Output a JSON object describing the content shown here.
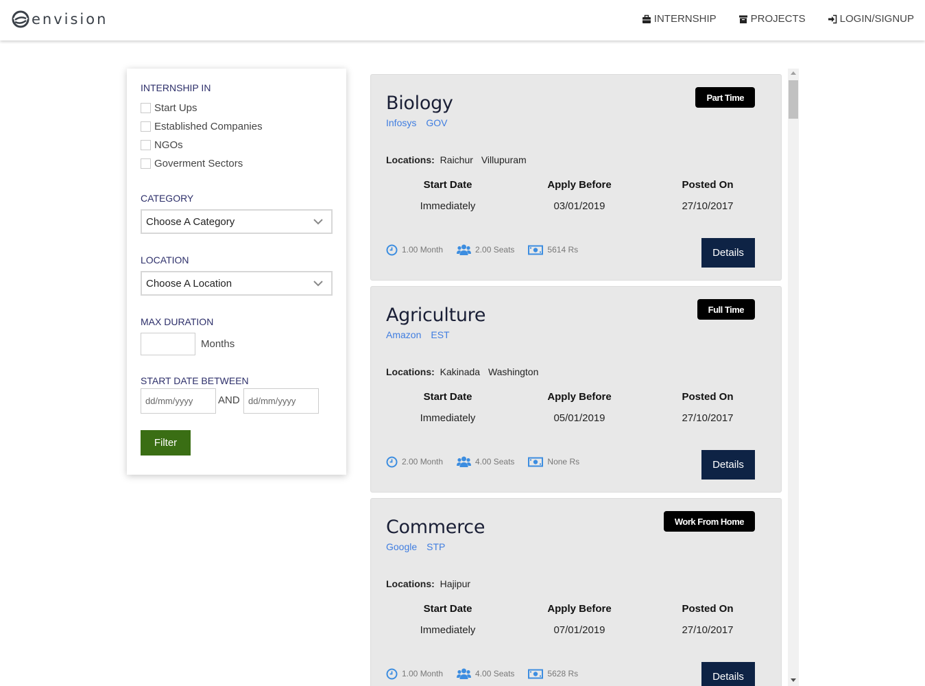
{
  "brand": {
    "name": "envision"
  },
  "nav": [
    {
      "label": "INTERNSHIP",
      "icon": "briefcase-icon"
    },
    {
      "label": "PROJECTS",
      "icon": "archive-icon"
    },
    {
      "label": "LOGIN/SIGNUP",
      "icon": "sign-in-icon"
    }
  ],
  "filter": {
    "internship_in": {
      "title": "INTERNSHIP IN",
      "options": [
        "Start Ups",
        "Established Companies",
        "NGOs",
        "Goverment Sectors"
      ]
    },
    "category": {
      "title": "CATEGORY",
      "selected": "Choose A Category"
    },
    "location": {
      "title": "LOCATION",
      "selected": "Choose A Location"
    },
    "max_duration": {
      "title": "MAX DURATION",
      "value": "",
      "unit": "Months"
    },
    "start_date": {
      "title": "START DATE BETWEEN",
      "from_placeholder": "dd/mm/yyyy",
      "and_label": "AND",
      "to_placeholder": "dd/mm/yyyy"
    },
    "button_label": "Filter",
    "colors": {
      "section_title": "#2d2f6a",
      "button": "#3a6e14"
    }
  },
  "listing": {
    "locations_label": "Locations:",
    "col_start": "Start Date",
    "col_apply": "Apply Before",
    "col_posted": "Posted On",
    "details_label": "Details",
    "cards": [
      {
        "title": "Biology",
        "tags": [
          "Infosys",
          "GOV"
        ],
        "badge": "Part Time",
        "locations": [
          "Raichur",
          "Villupuram"
        ],
        "start": "Immediately",
        "apply_before": "03/01/2019",
        "posted_on": "27/10/2017",
        "duration": "1.00 Month",
        "seats": "2.00 Seats",
        "stipend": "5614 Rs"
      },
      {
        "title": "Agriculture",
        "tags": [
          "Amazon",
          "EST"
        ],
        "badge": "Full Time",
        "locations": [
          "Kakinada",
          "Washington"
        ],
        "start": "Immediately",
        "apply_before": "05/01/2019",
        "posted_on": "27/10/2017",
        "duration": "2.00 Month",
        "seats": "4.00 Seats",
        "stipend": "None Rs"
      },
      {
        "title": "Commerce",
        "tags": [
          "Google",
          "STP"
        ],
        "badge": "Work From Home",
        "locations": [
          "Hajipur"
        ],
        "start": "Immediately",
        "apply_before": "07/01/2019",
        "posted_on": "27/10/2017",
        "duration": "1.00 Month",
        "seats": "4.00 Seats",
        "stipend": "5628 Rs"
      }
    ],
    "colors": {
      "card_bg": "#e8e8e8",
      "tag": "#3f7de0",
      "details_button": "#0e2345",
      "meta_icon": "#3c8de0"
    }
  }
}
